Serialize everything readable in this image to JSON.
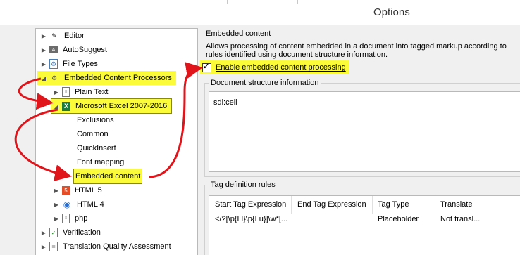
{
  "dialog": {
    "title": "Options"
  },
  "tree": {
    "items": [
      {
        "label": "Editor"
      },
      {
        "label": "AutoSuggest"
      },
      {
        "label": "File Types"
      },
      {
        "label": "Embedded Content Processors"
      },
      {
        "label": "Plain Text"
      },
      {
        "label": "Microsoft Excel 2007-2016"
      },
      {
        "label": "Exclusions"
      },
      {
        "label": "Common"
      },
      {
        "label": "QuickInsert"
      },
      {
        "label": "Font mapping"
      },
      {
        "label": "Embedded content"
      },
      {
        "label": "HTML 5"
      },
      {
        "label": "HTML 4"
      },
      {
        "label": "php"
      },
      {
        "label": "Verification"
      },
      {
        "label": "Translation Quality Assessment"
      }
    ]
  },
  "embedded": {
    "section_title": "Embedded content",
    "description": "Allows processing of content embedded in a document into tagged markup according to rules identified using document structure information.",
    "checkbox_label": "Enable embedded content processing",
    "checkbox_checked": true
  },
  "doc_structure": {
    "title": "Document structure information",
    "value": "sdl:cell"
  },
  "tag_rules": {
    "title": "Tag definition rules",
    "columns": [
      "Start Tag Expression",
      "End Tag Expression",
      "Tag Type",
      "Translate"
    ],
    "rows": [
      {
        "start": "</?[\\p{Ll}\\p{Lu}]\\w*[...",
        "end": "",
        "type": "Placeholder",
        "translate": "Not transl..."
      }
    ]
  },
  "colors": {
    "highlight": "#fbfb3a",
    "annotation_arrow": "#e0141b"
  }
}
